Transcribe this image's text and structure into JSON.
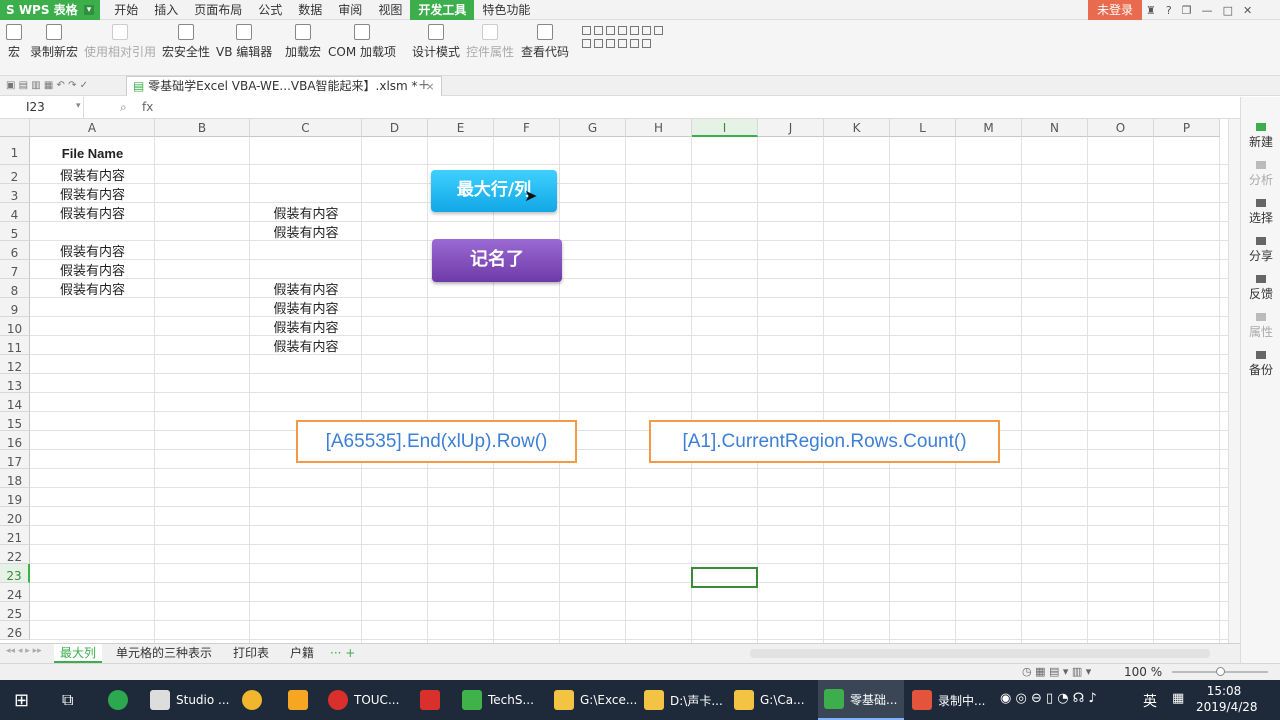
{
  "app": {
    "name": "S WPS 表格",
    "login": "未登录"
  },
  "menu": [
    "开始",
    "插入",
    "页面布局",
    "公式",
    "数据",
    "审阅",
    "视图",
    "开发工具",
    "特色功能"
  ],
  "ribbon": {
    "macro": "宏",
    "record": "录制新宏",
    "relative": "使用相对引用",
    "security": "宏安全性",
    "vb": "VB 编辑器",
    "addin": "加载宏",
    "com": "COM 加载项",
    "design": "设计模式",
    "props": "控件属性",
    "viewcode": "查看代码"
  },
  "document": {
    "tab_title": "零基础学Excel VBA-WE...VBA智能起来】.xlsm *",
    "close": "×",
    "add": "+"
  },
  "formula": {
    "cell_ref": "I23",
    "fx": "fx"
  },
  "columns": [
    "A",
    "B",
    "C",
    "D",
    "E",
    "F",
    "G",
    "H",
    "I",
    "J",
    "K",
    "L",
    "M",
    "N",
    "O",
    "P"
  ],
  "rows": [
    "1",
    "2",
    "3",
    "4",
    "5",
    "6",
    "7",
    "8",
    "9",
    "10",
    "11",
    "12",
    "13",
    "14",
    "15",
    "16",
    "17",
    "18",
    "19",
    "20",
    "21",
    "22",
    "23",
    "24",
    "25",
    "26"
  ],
  "cells": {
    "A1": "File Name",
    "A2": "假装有内容",
    "A3": "假装有内容",
    "A4": "假装有内容",
    "A6": "假装有内容",
    "A7": "假装有内容",
    "A8": "假装有内容",
    "C4": "假装有内容",
    "C5": "假装有内容",
    "C8": "假装有内容",
    "C9": "假装有内容",
    "C10": "假装有内容",
    "C11": "假装有内容"
  },
  "buttons": {
    "max_rowcol": "最大行/列",
    "record_name": "记名了"
  },
  "code_boxes": {
    "left": "[A65535].End(xlUp).Row()",
    "right": "[A1].CurrentRegion.Rows.Count()"
  },
  "sheets": [
    "最大列",
    "单元格的三种表示",
    "打印表",
    "户籍"
  ],
  "sheets_more": "··· +",
  "side_panel": [
    "新建",
    "分析",
    "选择",
    "分享",
    "反馈",
    "属性",
    "备份"
  ],
  "status": {
    "zoom": "100 %"
  },
  "taskbar": [
    "Studio ...",
    "TOUC...",
    "TechS...",
    "G:\\Exce...",
    "D:\\声卡...",
    "G:\\Ca...",
    "零基础...",
    "录制中..."
  ],
  "tray": {
    "ime": "英",
    "time": "15:08",
    "date": "2019/4/28"
  }
}
